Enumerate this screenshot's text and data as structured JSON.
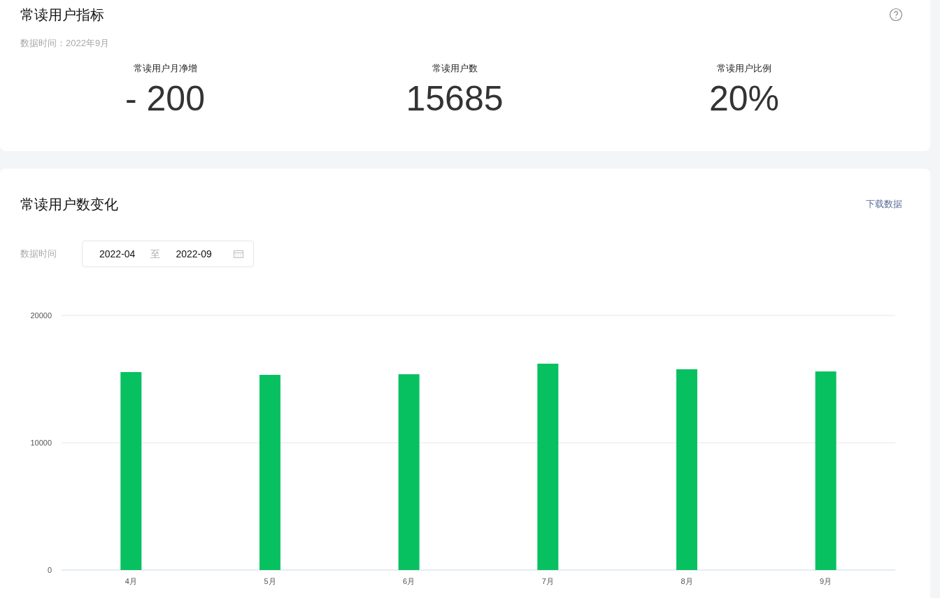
{
  "metrics_card": {
    "title": "常读用户指标",
    "data_time": "数据时间：2022年9月",
    "metrics": [
      {
        "label": "常读用户月净增",
        "value": "- 200"
      },
      {
        "label": "常读用户数",
        "value": "15685"
      },
      {
        "label": "常读用户比例",
        "value": "20%"
      }
    ]
  },
  "trend_card": {
    "title": "常读用户数变化",
    "download": "下载数据",
    "date_label": "数据时间",
    "date_start": "2022-04",
    "date_separator": "至",
    "date_end": "2022-09",
    "chart_data": {
      "type": "bar",
      "categories": [
        "4月",
        "5月",
        "6月",
        "7月",
        "8月",
        "9月"
      ],
      "series": [
        {
          "color": "#07c160",
          "values": [
            15550,
            15330,
            15380,
            16210,
            15770,
            15600
          ]
        }
      ],
      "ylim": [
        0,
        20000
      ],
      "yticks": [
        0,
        10000,
        20000
      ]
    }
  }
}
